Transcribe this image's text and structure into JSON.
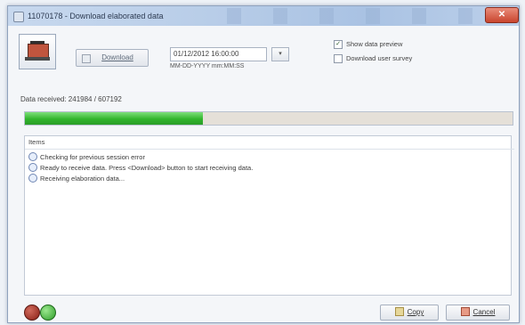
{
  "window": {
    "title": "11070178 - Download elaborated data",
    "close_glyph": "✕"
  },
  "toolbar": {
    "device_icon": "datalogger-icon",
    "download_label": "Download",
    "date_value": "01/12/2012 16:00:00",
    "date_dropdown_glyph": "▾",
    "date_format_hint": "MM-DD-YYYY mm:MM:SS",
    "show_preview_label": "Show data preview",
    "show_preview_checked": true,
    "download_survey_label": "Download user survey",
    "download_survey_checked": false
  },
  "status": {
    "received_text": "Data received: 241984 / 607192",
    "progress_fraction": 0.365,
    "progress_color": "#31b52c"
  },
  "log": {
    "header": "Items",
    "rows": [
      "Checking for previous session error",
      "Ready to receive data. Press <Download> button to start receiving data.",
      "Receiving elaboration data..."
    ]
  },
  "footer": {
    "copy_label": "Copy",
    "cancel_label": "Cancel",
    "led_red": "#8a1f16",
    "led_green": "#2f9d2a"
  }
}
